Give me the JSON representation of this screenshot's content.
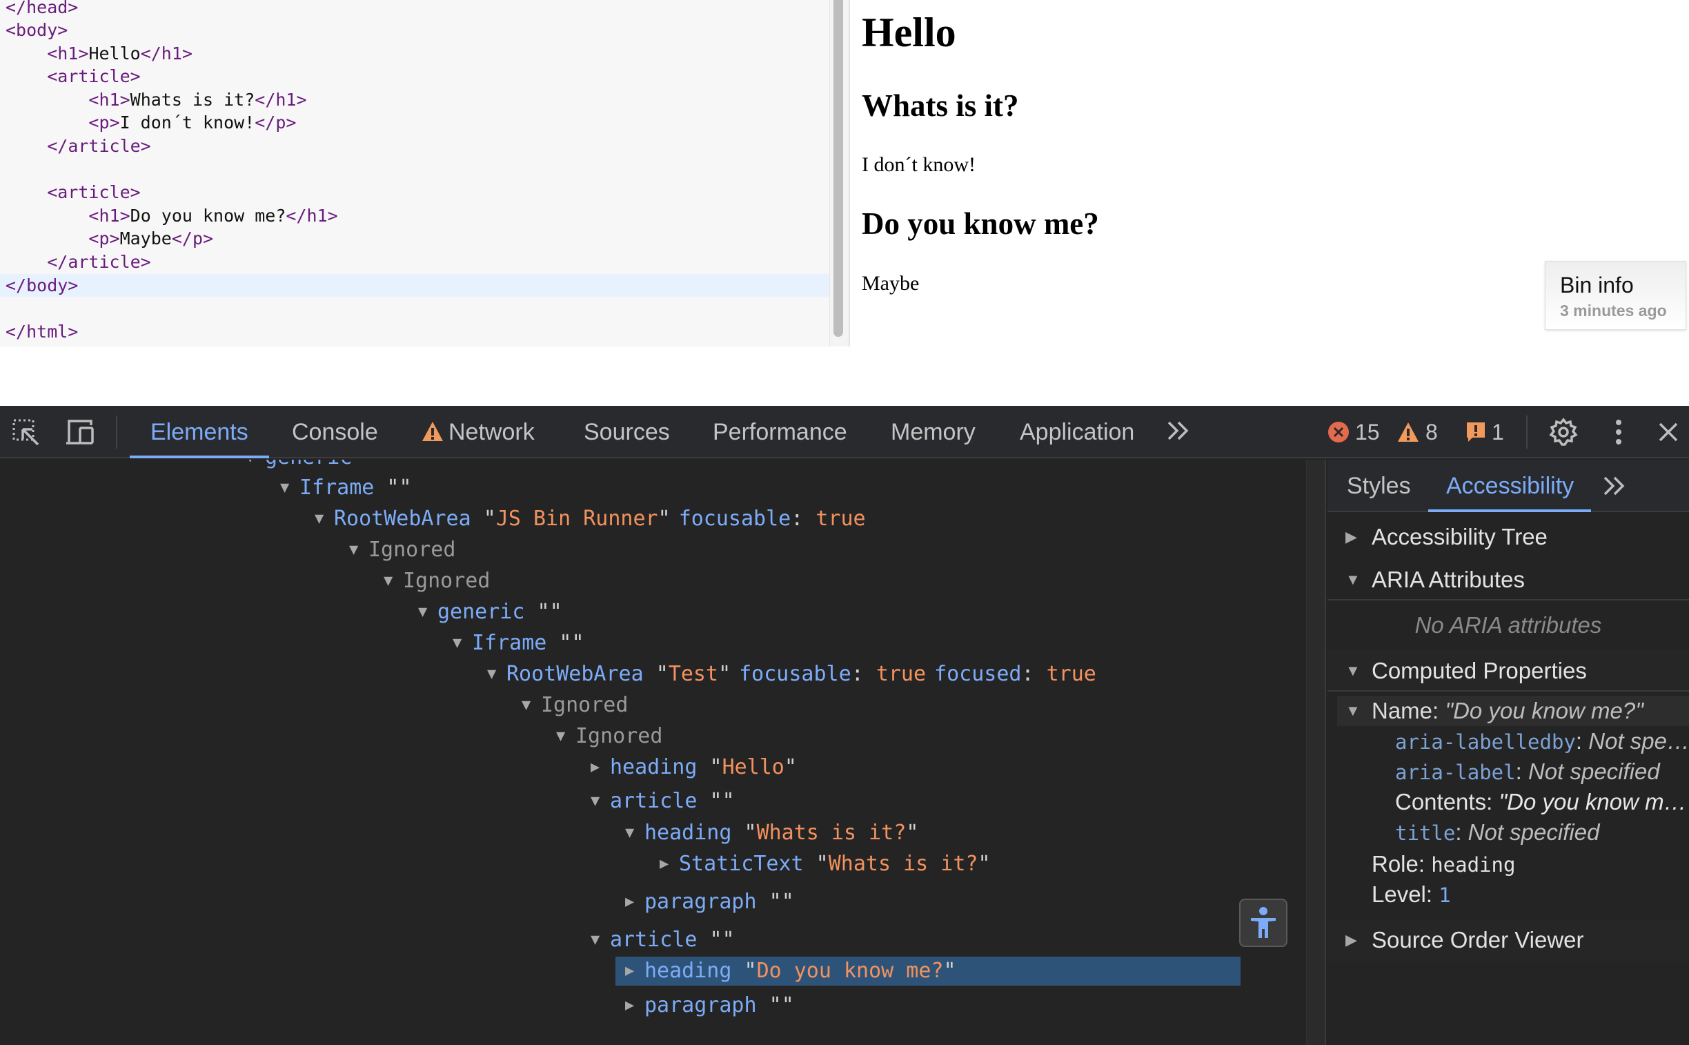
{
  "editor": {
    "lines": [
      {
        "indent": "",
        "parts": [
          {
            "t": "tag",
            "v": "</head>"
          }
        ]
      },
      {
        "indent": "",
        "parts": [
          {
            "t": "tag",
            "v": "<body>"
          }
        ]
      },
      {
        "indent": "    ",
        "parts": [
          {
            "t": "tag",
            "v": "<h1>"
          },
          {
            "t": "txt",
            "v": "Hello"
          },
          {
            "t": "tag",
            "v": "</h1>"
          }
        ]
      },
      {
        "indent": "    ",
        "parts": [
          {
            "t": "tag",
            "v": "<article>"
          }
        ]
      },
      {
        "indent": "        ",
        "parts": [
          {
            "t": "tag",
            "v": "<h1>"
          },
          {
            "t": "txt",
            "v": "Whats is it?"
          },
          {
            "t": "tag",
            "v": "</h1>"
          }
        ]
      },
      {
        "indent": "        ",
        "parts": [
          {
            "t": "tag",
            "v": "<p>"
          },
          {
            "t": "txt",
            "v": "I don´t know!"
          },
          {
            "t": "tag",
            "v": "</p>"
          }
        ]
      },
      {
        "indent": "    ",
        "parts": [
          {
            "t": "tag",
            "v": "</article>"
          }
        ]
      },
      {
        "indent": "",
        "parts": []
      },
      {
        "indent": "    ",
        "parts": [
          {
            "t": "tag",
            "v": "<article>"
          }
        ]
      },
      {
        "indent": "        ",
        "parts": [
          {
            "t": "tag",
            "v": "<h1>"
          },
          {
            "t": "txt",
            "v": "Do you know me?"
          },
          {
            "t": "tag",
            "v": "</h1>"
          }
        ]
      },
      {
        "indent": "        ",
        "parts": [
          {
            "t": "tag",
            "v": "<p>"
          },
          {
            "t": "txt",
            "v": "Maybe"
          },
          {
            "t": "tag",
            "v": "</p>"
          }
        ]
      },
      {
        "indent": "    ",
        "parts": [
          {
            "t": "tag",
            "v": "</article>"
          }
        ]
      },
      {
        "indent": "",
        "parts": [
          {
            "t": "tag",
            "v": "</body>"
          }
        ],
        "active": true
      },
      {
        "indent": "",
        "parts": []
      },
      {
        "indent": "",
        "parts": [
          {
            "t": "tag",
            "v": "</html>"
          }
        ]
      }
    ]
  },
  "output": {
    "h1": "Hello",
    "article1_heading": "Whats is it?",
    "article1_paragraph": "I don´t know!",
    "article2_heading": "Do you know me?",
    "article2_paragraph": "Maybe"
  },
  "bin_info": {
    "title": "Bin info",
    "time": "3 minutes ago"
  },
  "devtools": {
    "toolbar": {
      "inspect_icon": "inspect-element-icon",
      "device_icon": "device-toolbar-icon",
      "tabs": [
        {
          "label": "Elements",
          "active": true
        },
        {
          "label": "Console"
        },
        {
          "label": "Network",
          "warning": true
        },
        {
          "label": "Sources"
        },
        {
          "label": "Performance"
        },
        {
          "label": "Memory"
        },
        {
          "label": "Application"
        }
      ],
      "more_tabs": "»",
      "errors": "15",
      "warnings": "8",
      "issues": "1"
    },
    "tree": [
      {
        "depth": 0,
        "open": true,
        "role": "generic",
        "name": "",
        "props": []
      },
      {
        "depth": 1,
        "open": true,
        "role": "Iframe",
        "name": "",
        "props": []
      },
      {
        "depth": 2,
        "open": true,
        "role": "RootWebArea",
        "name": "JS Bin Runner",
        "props": [
          {
            "k": "focusable",
            "v": "true"
          }
        ]
      },
      {
        "depth": 3,
        "open": true,
        "role": "Ignored",
        "ignored": true,
        "props": []
      },
      {
        "depth": 4,
        "open": true,
        "role": "Ignored",
        "ignored": true,
        "props": []
      },
      {
        "depth": 5,
        "open": true,
        "role": "generic",
        "name": "",
        "props": []
      },
      {
        "depth": 6,
        "open": true,
        "role": "Iframe",
        "name": "",
        "props": []
      },
      {
        "depth": 7,
        "open": true,
        "role": "RootWebArea",
        "name": "Test",
        "props": [
          {
            "k": "focusable",
            "v": "true"
          },
          {
            "k": "focused",
            "v": "true"
          }
        ]
      },
      {
        "depth": 8,
        "open": true,
        "role": "Ignored",
        "ignored": true,
        "props": []
      },
      {
        "depth": 9,
        "open": true,
        "role": "Ignored",
        "ignored": true,
        "props": []
      },
      {
        "depth": 10,
        "open": false,
        "role": "heading",
        "name": "Hello",
        "props": []
      },
      {
        "depth": 10,
        "open": true,
        "role": "article",
        "name": "",
        "props": []
      },
      {
        "depth": 11,
        "open": true,
        "role": "heading",
        "name": "Whats is it?",
        "props": []
      },
      {
        "depth": 12,
        "open": false,
        "role": "StaticText",
        "name": "Whats is it?",
        "props": []
      },
      {
        "depth": 11,
        "open": false,
        "role": "paragraph",
        "name": "",
        "props": []
      },
      {
        "depth": 10,
        "open": true,
        "role": "article",
        "name": "",
        "props": []
      },
      {
        "depth": 11,
        "open": false,
        "role": "heading",
        "name": "Do you know me?",
        "props": [],
        "selected": true
      },
      {
        "depth": 11,
        "open": false,
        "role": "paragraph",
        "name": "",
        "props": []
      }
    ],
    "sidebar": {
      "tabs": [
        {
          "label": "Styles"
        },
        {
          "label": "Accessibility",
          "active": true
        }
      ],
      "more_tabs": "»",
      "sections": {
        "accessibility_tree": "Accessibility Tree",
        "aria_attributes": "ARIA Attributes",
        "no_aria": "No ARIA attributes",
        "computed_properties": "Computed Properties",
        "source_order_viewer": "Source Order Viewer"
      },
      "computed": {
        "name_label": "Name:",
        "name_value": "\"Do you know me?\"",
        "aria_labelledby_key": "aria-labelledby",
        "aria_labelledby_value": "Not spe…",
        "aria_label_key": "aria-label",
        "aria_label_value": "Not specified",
        "contents_label": "Contents:",
        "contents_value": "\"Do you know m…",
        "title_key": "title",
        "title_value": "Not specified",
        "role_label": "Role:",
        "role_value": "heading",
        "level_label": "Level:",
        "level_value": "1"
      }
    },
    "colors": {
      "accent": "#7cacf8",
      "name_orange": "#f2925e",
      "error_red": "#e46a4e",
      "warning_orange": "#f29a5c",
      "selected_row": "#2e5378"
    }
  }
}
